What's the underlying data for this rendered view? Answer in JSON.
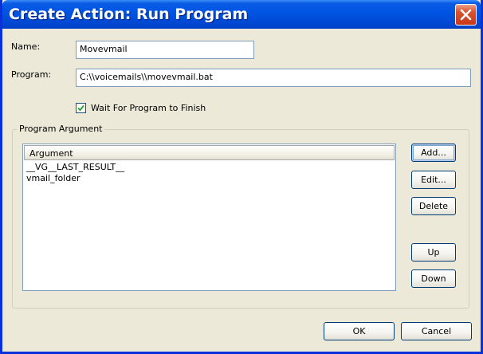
{
  "window": {
    "title": "Create Action: Run Program"
  },
  "form": {
    "name_label": "Name:",
    "name_value": "Movevmail",
    "program_label": "Program:",
    "program_value": "C:\\\\voicemails\\\\movevmail.bat",
    "wait_checkbox_label": "Wait For Program to Finish",
    "wait_checked": true
  },
  "arguments_group": {
    "title": "Program Argument",
    "column_header": "Argument",
    "rows": [
      "__VG__LAST_RESULT__",
      "vmail_folder"
    ],
    "buttons": {
      "add": "Add...",
      "edit": "Edit...",
      "delete": "Delete",
      "up": "Up",
      "down": "Down"
    }
  },
  "footer": {
    "ok": "OK",
    "cancel": "Cancel"
  },
  "colors": {
    "title_bar": "#0054e3",
    "close_button": "#d9542d",
    "dialog_bg": "#ece9d8"
  }
}
